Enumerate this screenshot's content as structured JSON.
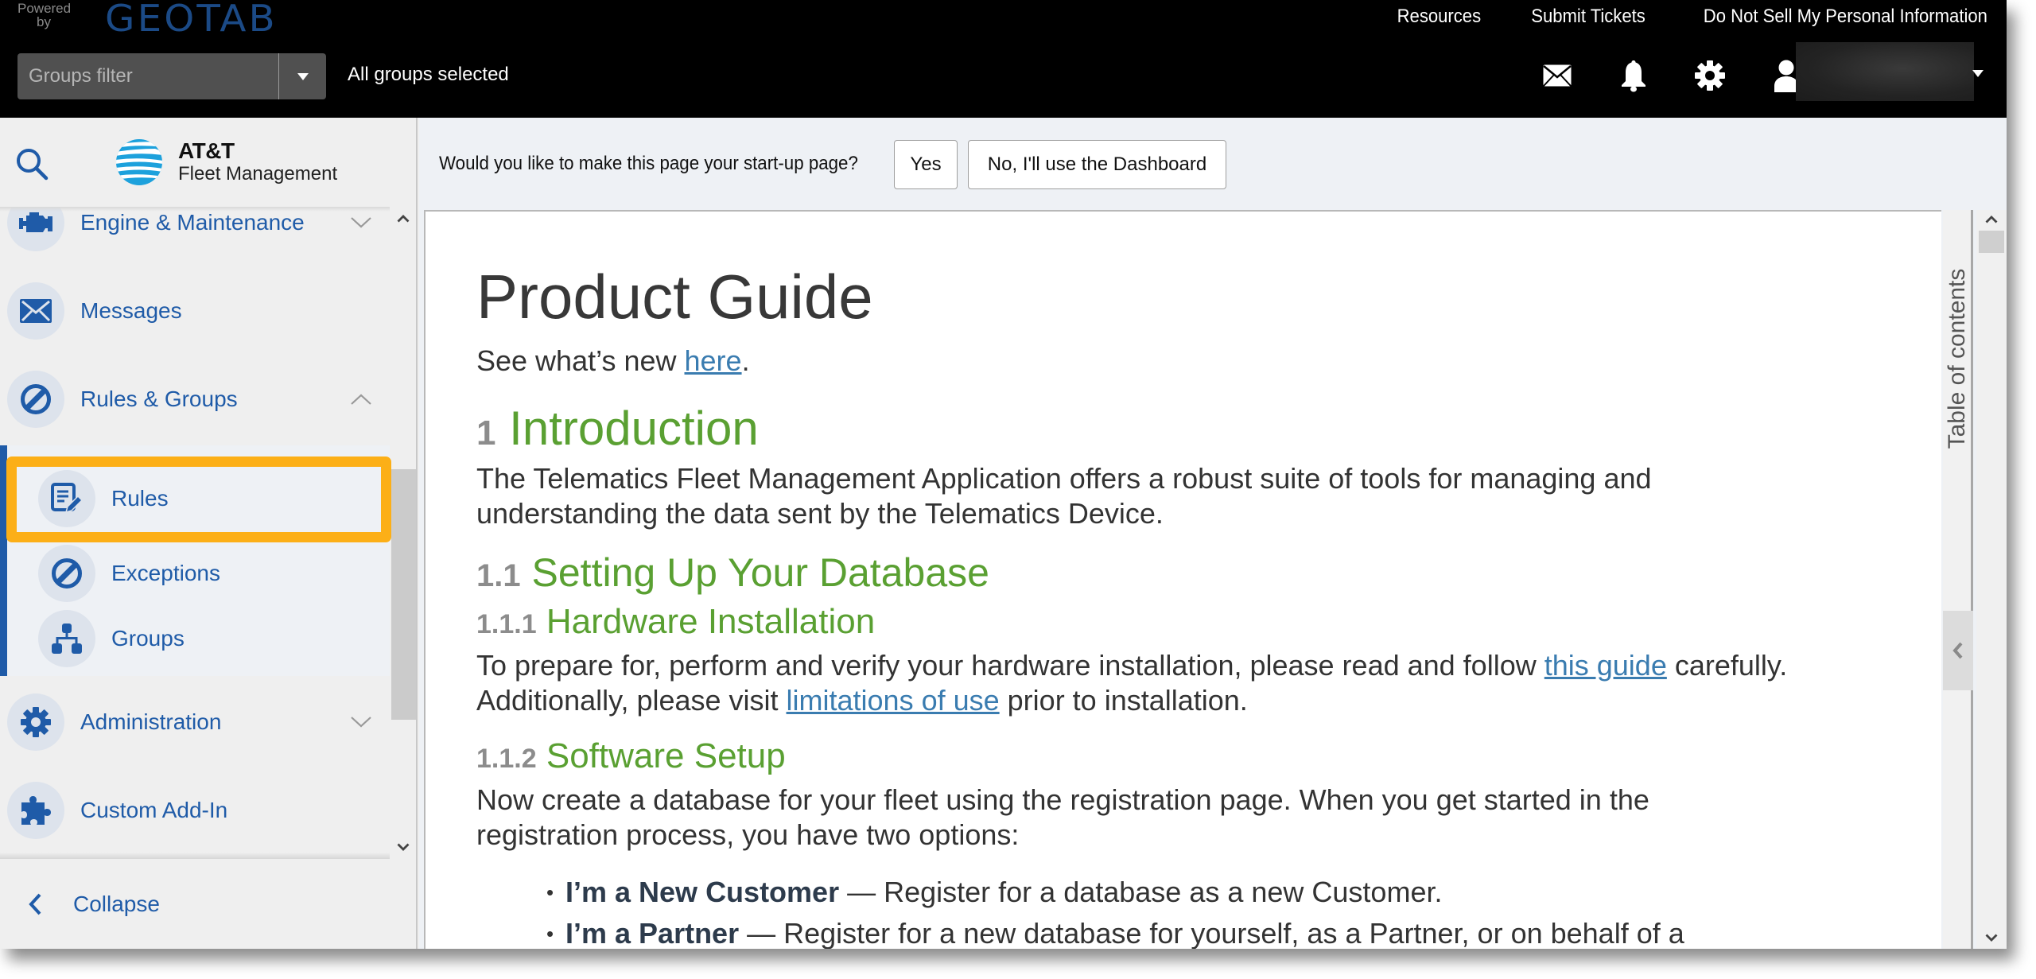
{
  "header": {
    "powered_by": "Powered by",
    "brand": "GEOTAB",
    "links": [
      "Resources",
      "Submit Tickets",
      "Do Not Sell My Personal Information"
    ],
    "groups_filter": {
      "placeholder": "Groups filter",
      "status": "All groups selected"
    },
    "icons": [
      "mail-icon",
      "bell-icon",
      "gear-icon",
      "user-icon"
    ]
  },
  "sidebar": {
    "logo": {
      "name": "AT&T",
      "subtitle": "Fleet Management"
    },
    "items": [
      {
        "label": "Engine & Maintenance",
        "icon": "engine-icon",
        "expanded": false
      },
      {
        "label": "Messages",
        "icon": "envelope-icon"
      },
      {
        "label": "Rules & Groups",
        "icon": "prohibited-icon",
        "expanded": true
      }
    ],
    "subitems": [
      {
        "label": "Rules",
        "icon": "rules-edit-icon",
        "highlighted": true
      },
      {
        "label": "Exceptions",
        "icon": "prohibited-icon"
      },
      {
        "label": "Groups",
        "icon": "hierarchy-icon"
      }
    ],
    "items_after": [
      {
        "label": "Administration",
        "icon": "gear-icon",
        "expanded": false
      },
      {
        "label": "Custom Add-In",
        "icon": "puzzle-icon"
      }
    ],
    "collapse_label": "Collapse",
    "highlight_color": "#fcaf17",
    "accent_color": "#1f5ba8"
  },
  "startup": {
    "question": "Would you like to make this page your start-up page?",
    "yes_label": "Yes",
    "no_label": "No, I'll use the Dashboard"
  },
  "doc": {
    "title": "Product Guide",
    "whats_new_prefix": "See what’s new ",
    "whats_new_link": "here",
    "whats_new_suffix": ".",
    "sections": {
      "intro_num": "1",
      "intro_title": "Introduction",
      "intro_text": "The Telematics Fleet Management Application offers a robust suite of tools for managing and understanding the data sent by the Telematics Device.",
      "db_num": "1.1",
      "db_title": "Setting Up Your Database",
      "hw_num": "1.1.1",
      "hw_title": "Hardware Installation",
      "hw_text_1": "To prepare for, perform and verify your hardware installation, please read and follow ",
      "hw_link_1": "this guide",
      "hw_text_2": " carefully. Additionally, please visit ",
      "hw_link_2": "limitations of use",
      "hw_text_3": " prior to installation.",
      "sw_num": "1.1.2",
      "sw_title": "Software Setup",
      "sw_text": "Now create a database for your fleet using the registration page. When you get started in the registration process, you have two options:",
      "options": [
        {
          "bold": "I’m a New Customer",
          "text": " — Register for a database as a new Customer."
        },
        {
          "bold": "I’m a Partner",
          "text": " — Register for a new database for yourself, as a Partner, or on behalf of a"
        }
      ]
    },
    "heading_color": "#5aa032",
    "link_color": "#3a7cb0"
  },
  "toc": {
    "label": "Table of contents"
  }
}
